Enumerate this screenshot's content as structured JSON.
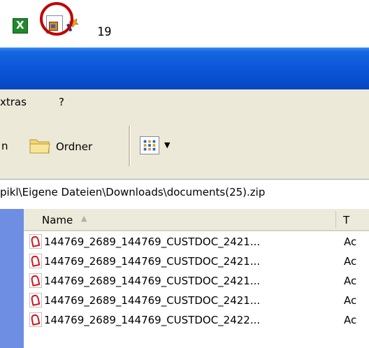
{
  "top": {
    "count": "19"
  },
  "menu": {
    "items": [
      "xtras",
      "?"
    ]
  },
  "toolbar": {
    "back_label_fragment": "n",
    "folders_label": "Ordner"
  },
  "address": {
    "path": "pikl\\Eigene Dateien\\Downloads\\documents(25).zip"
  },
  "list": {
    "columns": [
      "Name",
      "T"
    ],
    "rows": [
      {
        "name": "144769_2689_144769_CUSTDOC_2421...",
        "type": "Ac"
      },
      {
        "name": "144769_2689_144769_CUSTDOC_2421...",
        "type": "Ac"
      },
      {
        "name": "144769_2689_144769_CUSTDOC_2421...",
        "type": "Ac"
      },
      {
        "name": "144769_2689_144769_CUSTDOC_2421...",
        "type": "Ac"
      },
      {
        "name": "144769_2689_144769_CUSTDOC_2422...",
        "type": "Ac"
      }
    ]
  },
  "icons": {
    "excel": "excel-icon",
    "document": "document-icon",
    "wand": "wand-icon",
    "folder": "folder-icon",
    "views": "views-icon",
    "sort": "sort-ascending-icon",
    "pdf": "pdf-icon"
  },
  "colors": {
    "highlight_circle": "#c00000",
    "titlebar": "#0a54d8",
    "left_panel": "#6e8ee4"
  }
}
